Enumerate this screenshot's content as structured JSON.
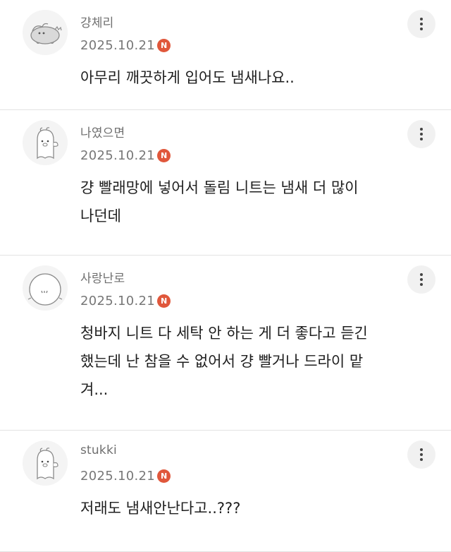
{
  "comments": [
    {
      "nickname": "걍체리",
      "date": "2025.10.21",
      "badge": "N",
      "text": "아무리 깨끗하게 입어도 냄새나요..",
      "avatar_icon": "dog-avatar-icon"
    },
    {
      "nickname": "나였으면",
      "date": "2025.10.21",
      "badge": "N",
      "text": "걍 빨래망에 넣어서 돌림 니트는 냄새 더 많이나던데",
      "avatar_icon": "ghost-character-avatar-icon"
    },
    {
      "nickname": "사랑난로",
      "date": "2025.10.21",
      "badge": "N",
      "text": "청바지 니트 다 세탁 안 하는 게 더 좋다고 듣긴 했는데 난 참을 수 없어서 걍 빨거나 드라이 맡겨...",
      "avatar_icon": "round-face-avatar-icon"
    },
    {
      "nickname": "stukki",
      "date": "2025.10.21",
      "badge": "N",
      "text": "저래도 냄새안난다고..???",
      "avatar_icon": "ghost-character-avatar-icon"
    }
  ],
  "colors": {
    "badge": "#e0573b",
    "divider": "#e3e3e3",
    "meta_text": "#777777"
  }
}
